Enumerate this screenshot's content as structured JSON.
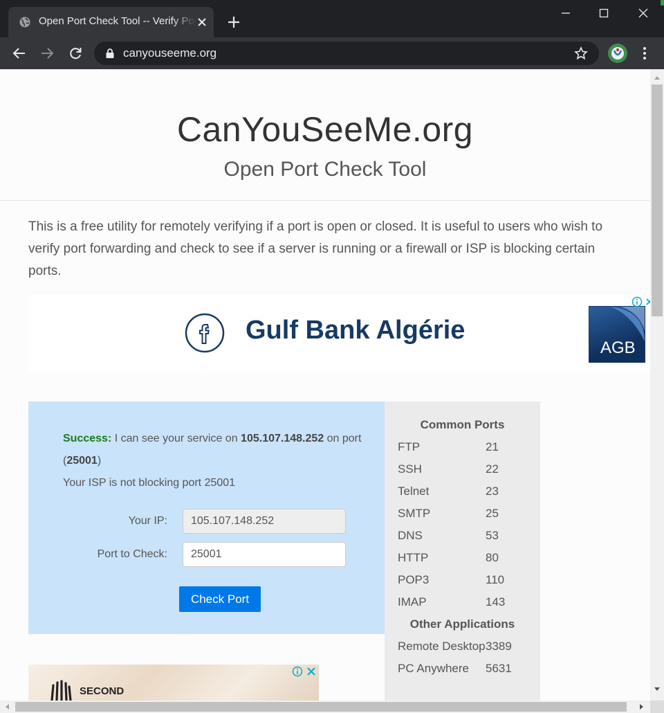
{
  "browser": {
    "tab_title": "Open Port Check Tool -- Verify Port Forwarding",
    "url": "canyouseeme.org"
  },
  "header": {
    "title": "CanYouSeeMe.org",
    "subtitle": "Open Port Check Tool"
  },
  "intro": "This is a free utility for remotely verifying if a port is open or closed. It is useful to users who wish to verify port forwarding and check to see if a server is running or a firewall or ISP is blocking certain ports.",
  "ad_banner": {
    "text": "Gulf Bank Algérie",
    "logo_text": "AGB"
  },
  "result": {
    "success_label": "Success:",
    "msg_part1": "I can see your service on",
    "ip": "105.107.148.252",
    "msg_part2": "on port (",
    "port": "25001",
    "msg_part3": ")",
    "isp_msg": "Your ISP is not blocking port 25001"
  },
  "form": {
    "ip_label": "Your IP:",
    "ip_value": "105.107.148.252",
    "port_label": "Port to Check:",
    "port_value": "25001",
    "button_label": "Check Port"
  },
  "ports": {
    "heading": "Common Ports",
    "items": [
      {
        "name": "FTP",
        "port": "21"
      },
      {
        "name": "SSH",
        "port": "22"
      },
      {
        "name": "Telnet",
        "port": "23"
      },
      {
        "name": "SMTP",
        "port": "25"
      },
      {
        "name": "DNS",
        "port": "53"
      },
      {
        "name": "HTTP",
        "port": "80"
      },
      {
        "name": "POP3",
        "port": "110"
      },
      {
        "name": "IMAP",
        "port": "143"
      }
    ],
    "apps_heading": "Other Applications",
    "apps": [
      {
        "name": "Remote Desktop",
        "port": "3389"
      },
      {
        "name": "PC Anywhere",
        "port": "5631"
      }
    ]
  },
  "ad_bottom": {
    "text": "SECOND"
  },
  "colors": {
    "result_bg": "#c9e3fa",
    "success": "#1a7a1a",
    "button": "#0078e7",
    "ports_bg": "#ebebeb"
  }
}
